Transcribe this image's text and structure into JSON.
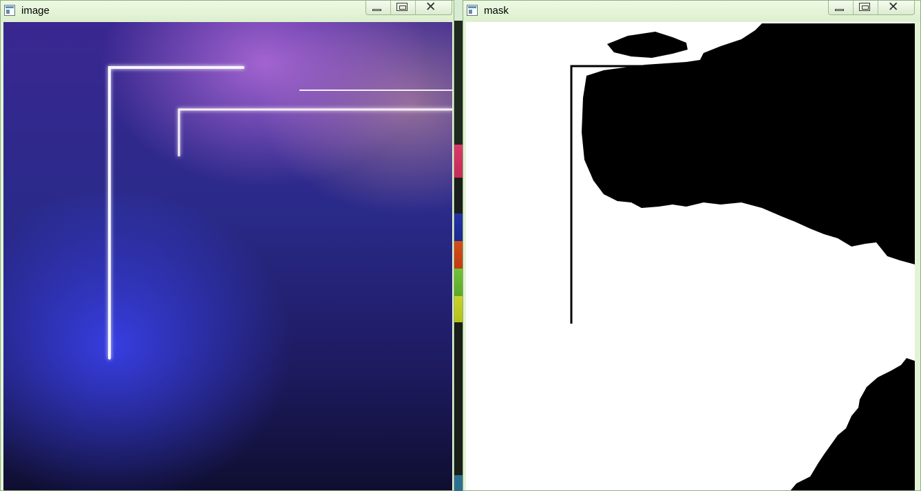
{
  "windows": [
    {
      "id": "image",
      "title": "image",
      "controls": {
        "minimize": "minimize",
        "maximize": "maximize",
        "close": "close"
      }
    },
    {
      "id": "mask",
      "title": "mask",
      "controls": {
        "minimize": "minimize",
        "maximize": "maximize",
        "close": "close"
      }
    }
  ],
  "colors": {
    "titlebar": "#e3f3d6",
    "image_neon": "#f4f3ff",
    "image_pink_glow": "#d850c8",
    "mask_foreground": "#000000",
    "mask_background": "#ffffff"
  }
}
